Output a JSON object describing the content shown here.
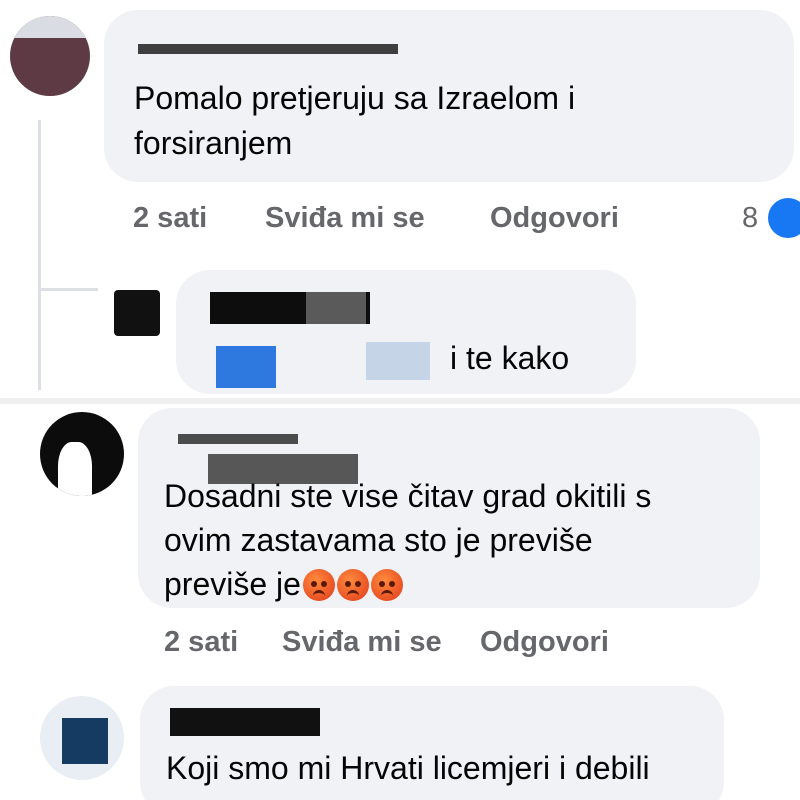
{
  "comments": [
    {
      "text_lines": [
        "Pomalo pretjeruju sa Izraelom i",
        "forsiranjem"
      ],
      "time": "2 sati",
      "like_label": "Sviđa mi se",
      "reply_label": "Odgovori",
      "reaction_count": "8"
    },
    {
      "text": "i te kako"
    },
    {
      "text_lines": [
        "Dosadni ste vise čitav grad okitili s",
        "ovim zastavama sto je previše",
        "previše je"
      ],
      "emoji": [
        "angry-face",
        "angry-face",
        "angry-face"
      ],
      "time": "2 sati",
      "like_label": "Sviđa mi se",
      "reply_label": "Odgovori"
    },
    {
      "text": "Koji smo mi Hrvati licemjeri i debili"
    }
  ],
  "colors": {
    "bubble": "#f0f2f5",
    "meta": "#65676b",
    "reaction_like": "#1877f2"
  }
}
